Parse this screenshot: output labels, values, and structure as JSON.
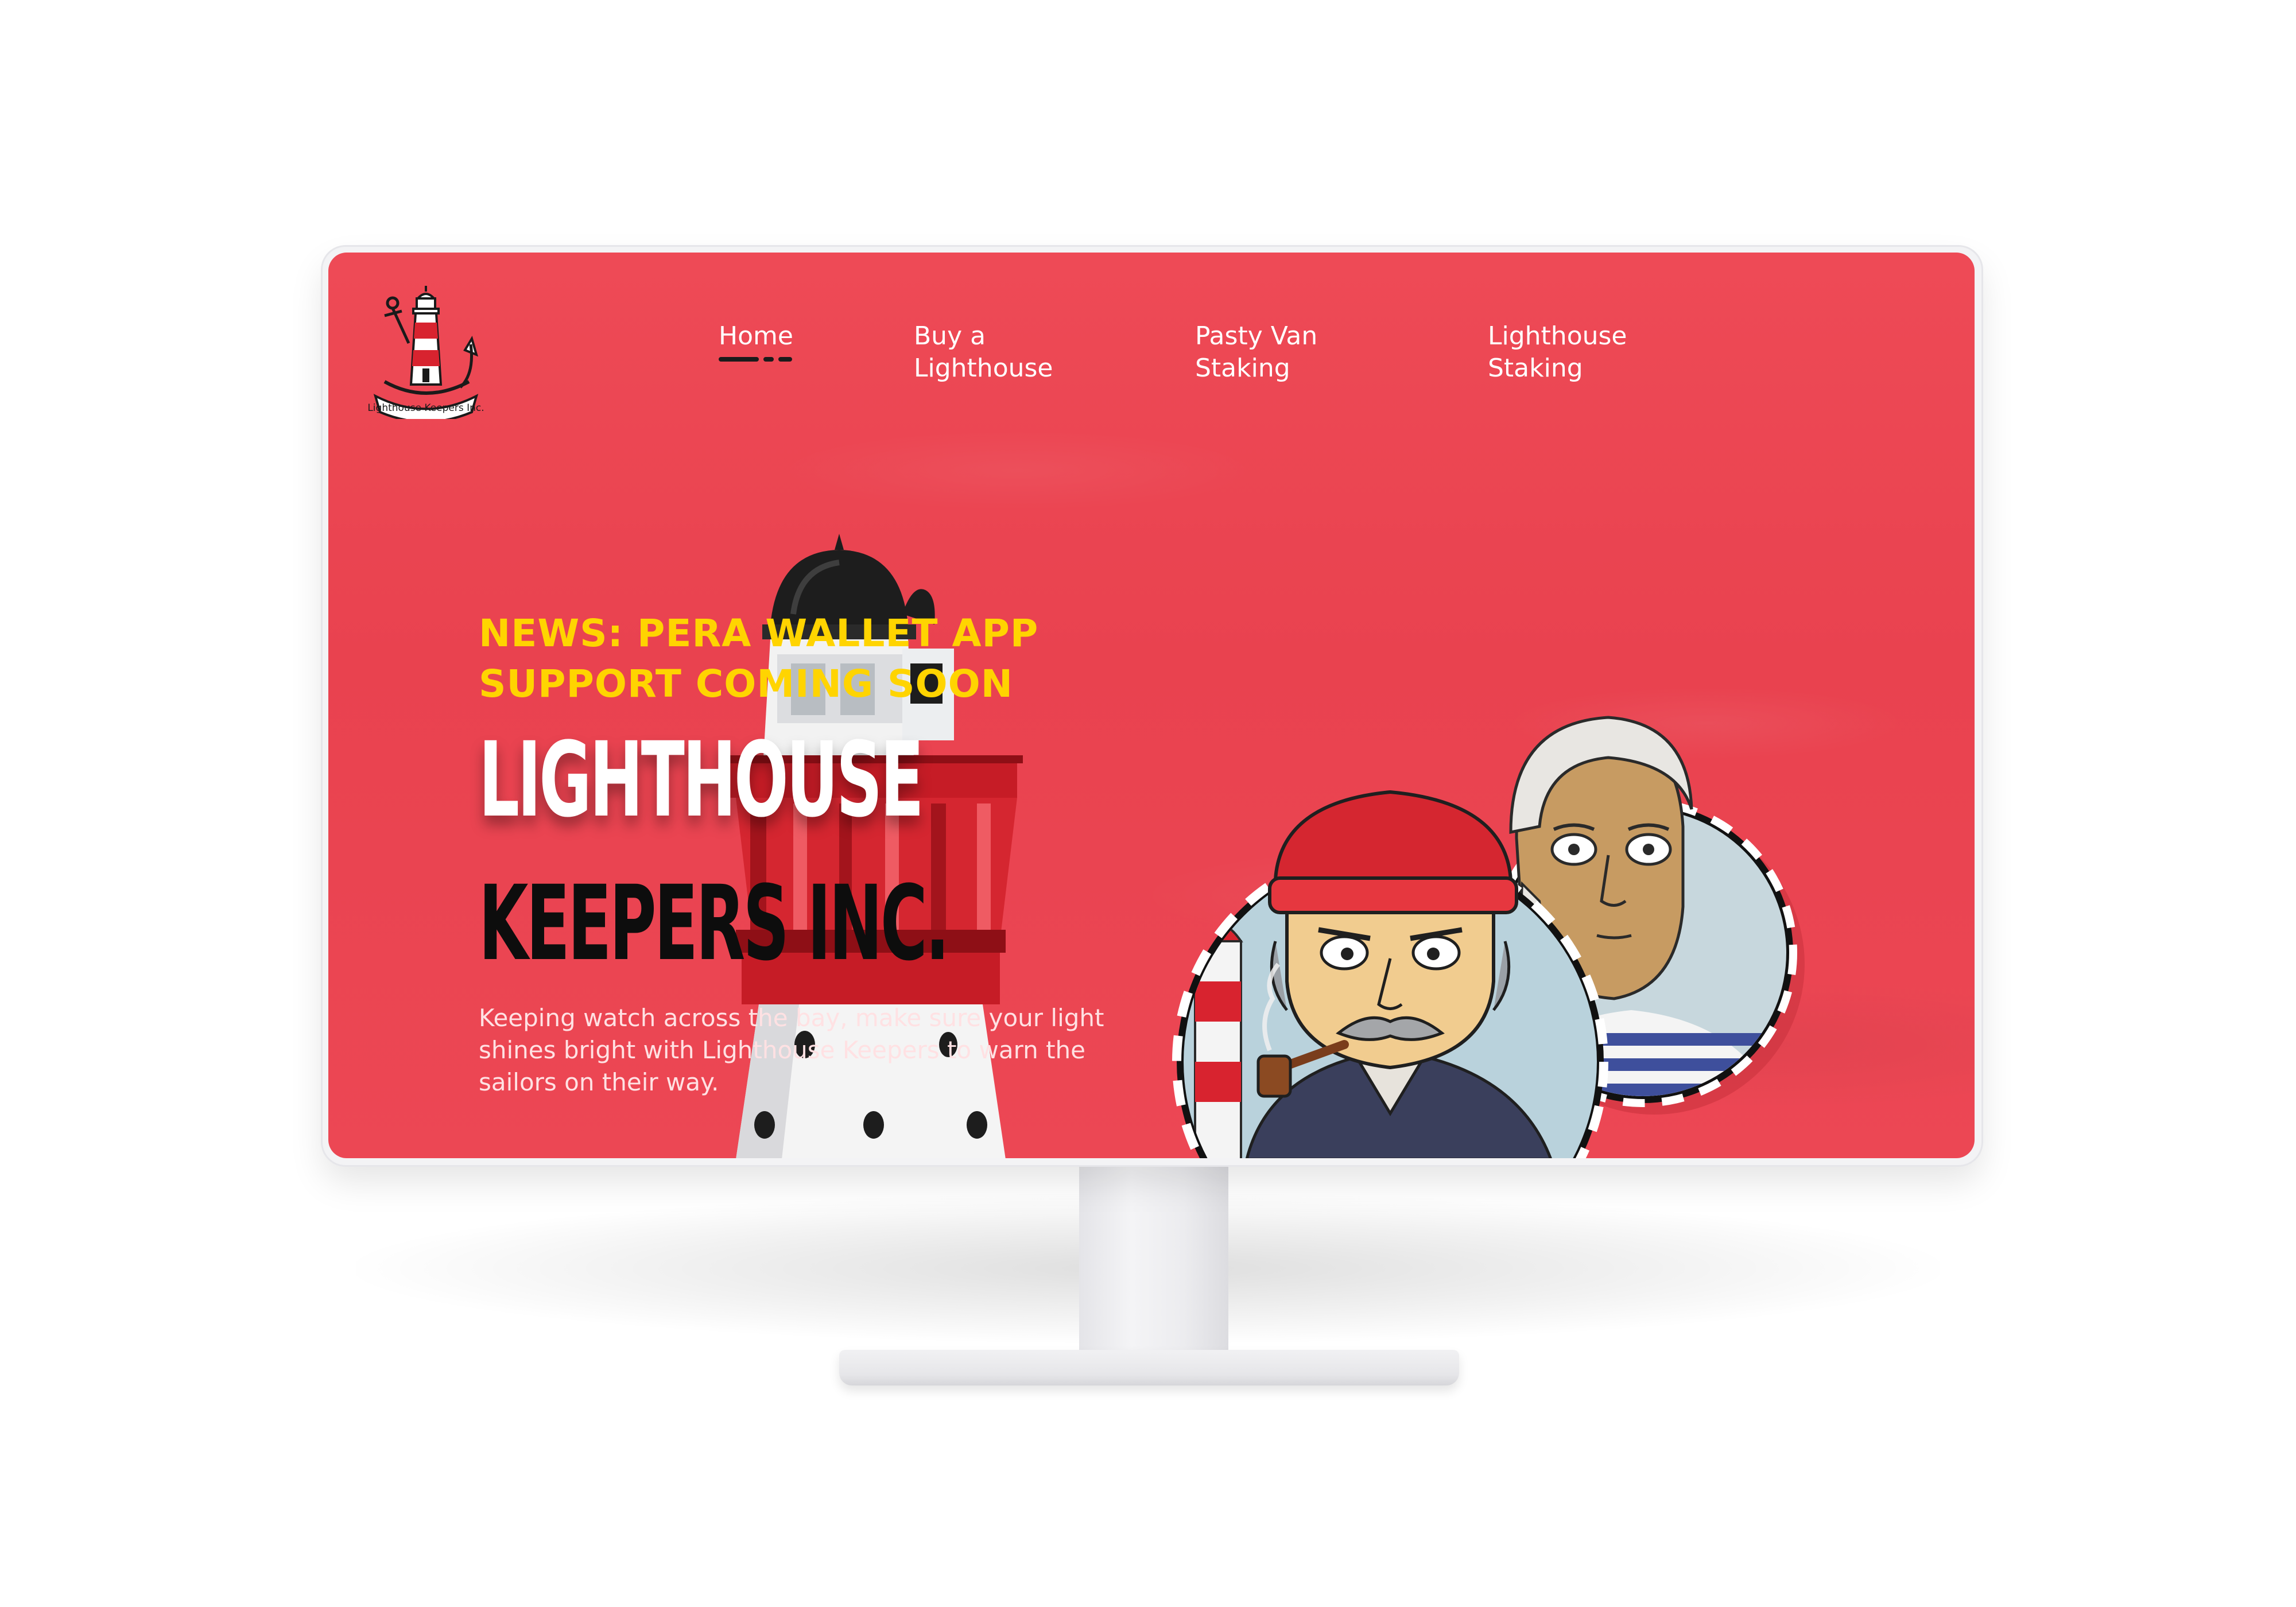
{
  "site": {
    "logo_text": "Lighthouse Keepers Inc."
  },
  "nav": {
    "items": [
      {
        "label": "Home",
        "active": true
      },
      {
        "label": "Buy a\nLighthouse",
        "active": false
      },
      {
        "label": "Pasty Van\nStaking",
        "active": false
      },
      {
        "label": "Lighthouse\nStaking",
        "active": false
      }
    ]
  },
  "hero": {
    "news": "NEWS: PERA WALLET APP SUPPORT COMING SOON",
    "title_line1": "LIGHTHOUSE",
    "title_line2": "KEEPERS INC.",
    "subtitle": "Keeping watch across the bay, make sure your light shines bright with Lighthouse Keepers to warn the sailors on their way."
  },
  "colors": {
    "background": "#eb4551",
    "news_yellow": "#ffd400",
    "title_white": "#ffffff",
    "title_black": "#0d0d0d"
  },
  "images": {
    "lighthouse": "lighthouse-photo",
    "avatar_front": "keeper-red-beanie-pipe-avatar",
    "avatar_back": "keeper-white-hair-striped-shirt-avatar"
  }
}
